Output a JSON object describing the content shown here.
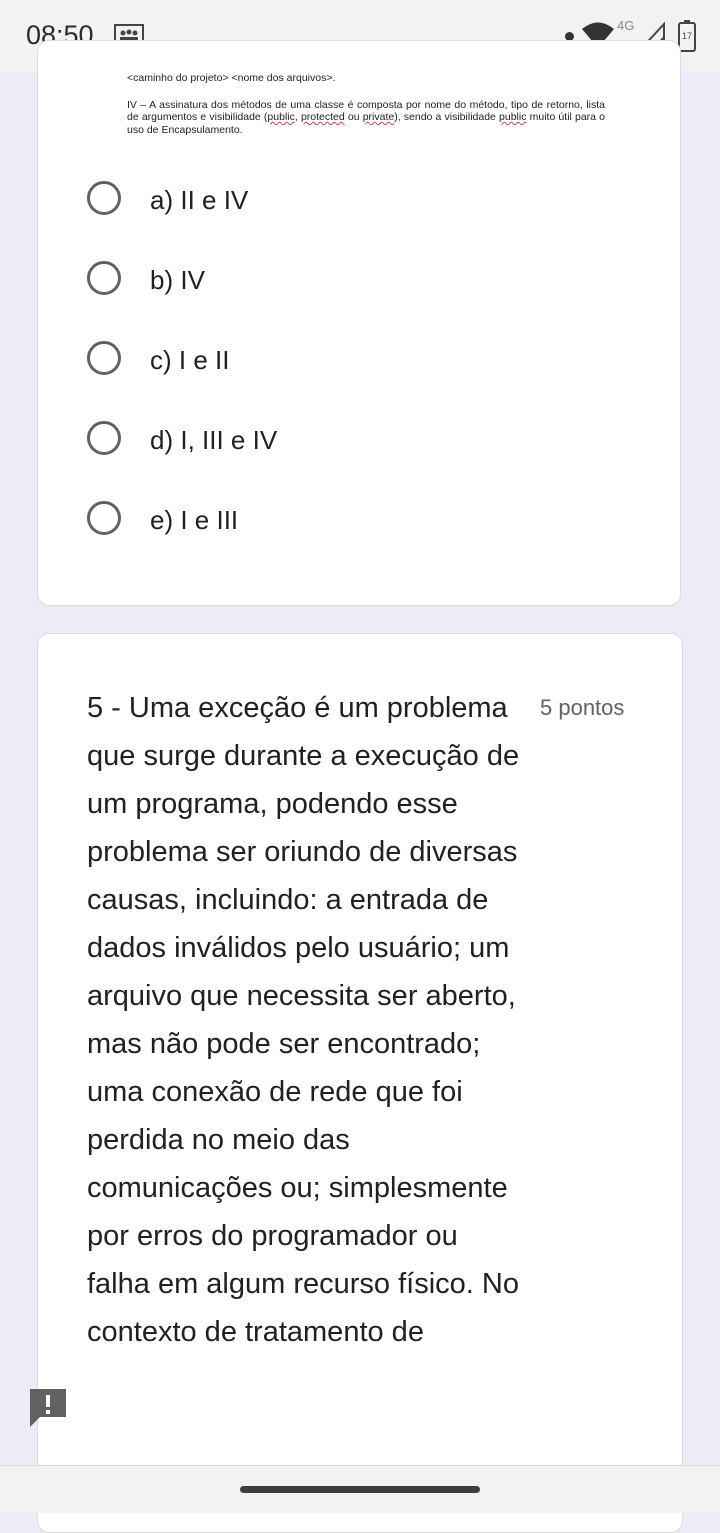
{
  "status": {
    "time": "08:50",
    "network": "4G",
    "battery": "17"
  },
  "doc": {
    "path_line": "<caminho do projeto> <nome dos arquivos>.",
    "para": [
      {
        "text": "IV – A assinatura dos métodos de uma classe é composta por nome do método, tipo de retorno, lista de argumentos e visibilidade (",
        "sq": false
      },
      {
        "text": "public",
        "sq": true
      },
      {
        "text": ", ",
        "sq": false
      },
      {
        "text": "protected",
        "sq": true
      },
      {
        "text": " ou ",
        "sq": false
      },
      {
        "text": "private",
        "sq": true
      },
      {
        "text": "), sendo a visibilidade ",
        "sq": false
      },
      {
        "text": "public",
        "sq": true
      },
      {
        "text": " muito útil para o uso de Encapsulamento.",
        "sq": false
      }
    ]
  },
  "options": [
    {
      "label": "a) II e IV"
    },
    {
      "label": "b) IV"
    },
    {
      "label": "c) I e II"
    },
    {
      "label": "d) I, III e IV"
    },
    {
      "label": "e) I e III"
    }
  ],
  "question": {
    "text": "5 - Uma exceção é um problema que surge durante a execução de um programa, podendo esse problema ser oriundo de diversas causas, incluindo: a entrada de dados inválidos pelo usuário; um arquivo que necessita ser aberto, mas não pode ser encontrado; uma conexão de rede que foi perdida no meio das comunicações ou; simplesmente por erros do programador ou falha em algum recurso físico. No contexto de tratamento de",
    "points": "5 pontos"
  },
  "icons": {
    "notification": "notification-icon",
    "wifi": "wifi-icon",
    "signal": "signal-icon",
    "battery": "battery-icon",
    "feedback": "feedback-icon"
  },
  "colors": {
    "page_bg": "#eeeaf7",
    "card_bg": "#ffffff",
    "radio": "#5f6368",
    "text": "#202124",
    "muted": "#5f6368"
  }
}
